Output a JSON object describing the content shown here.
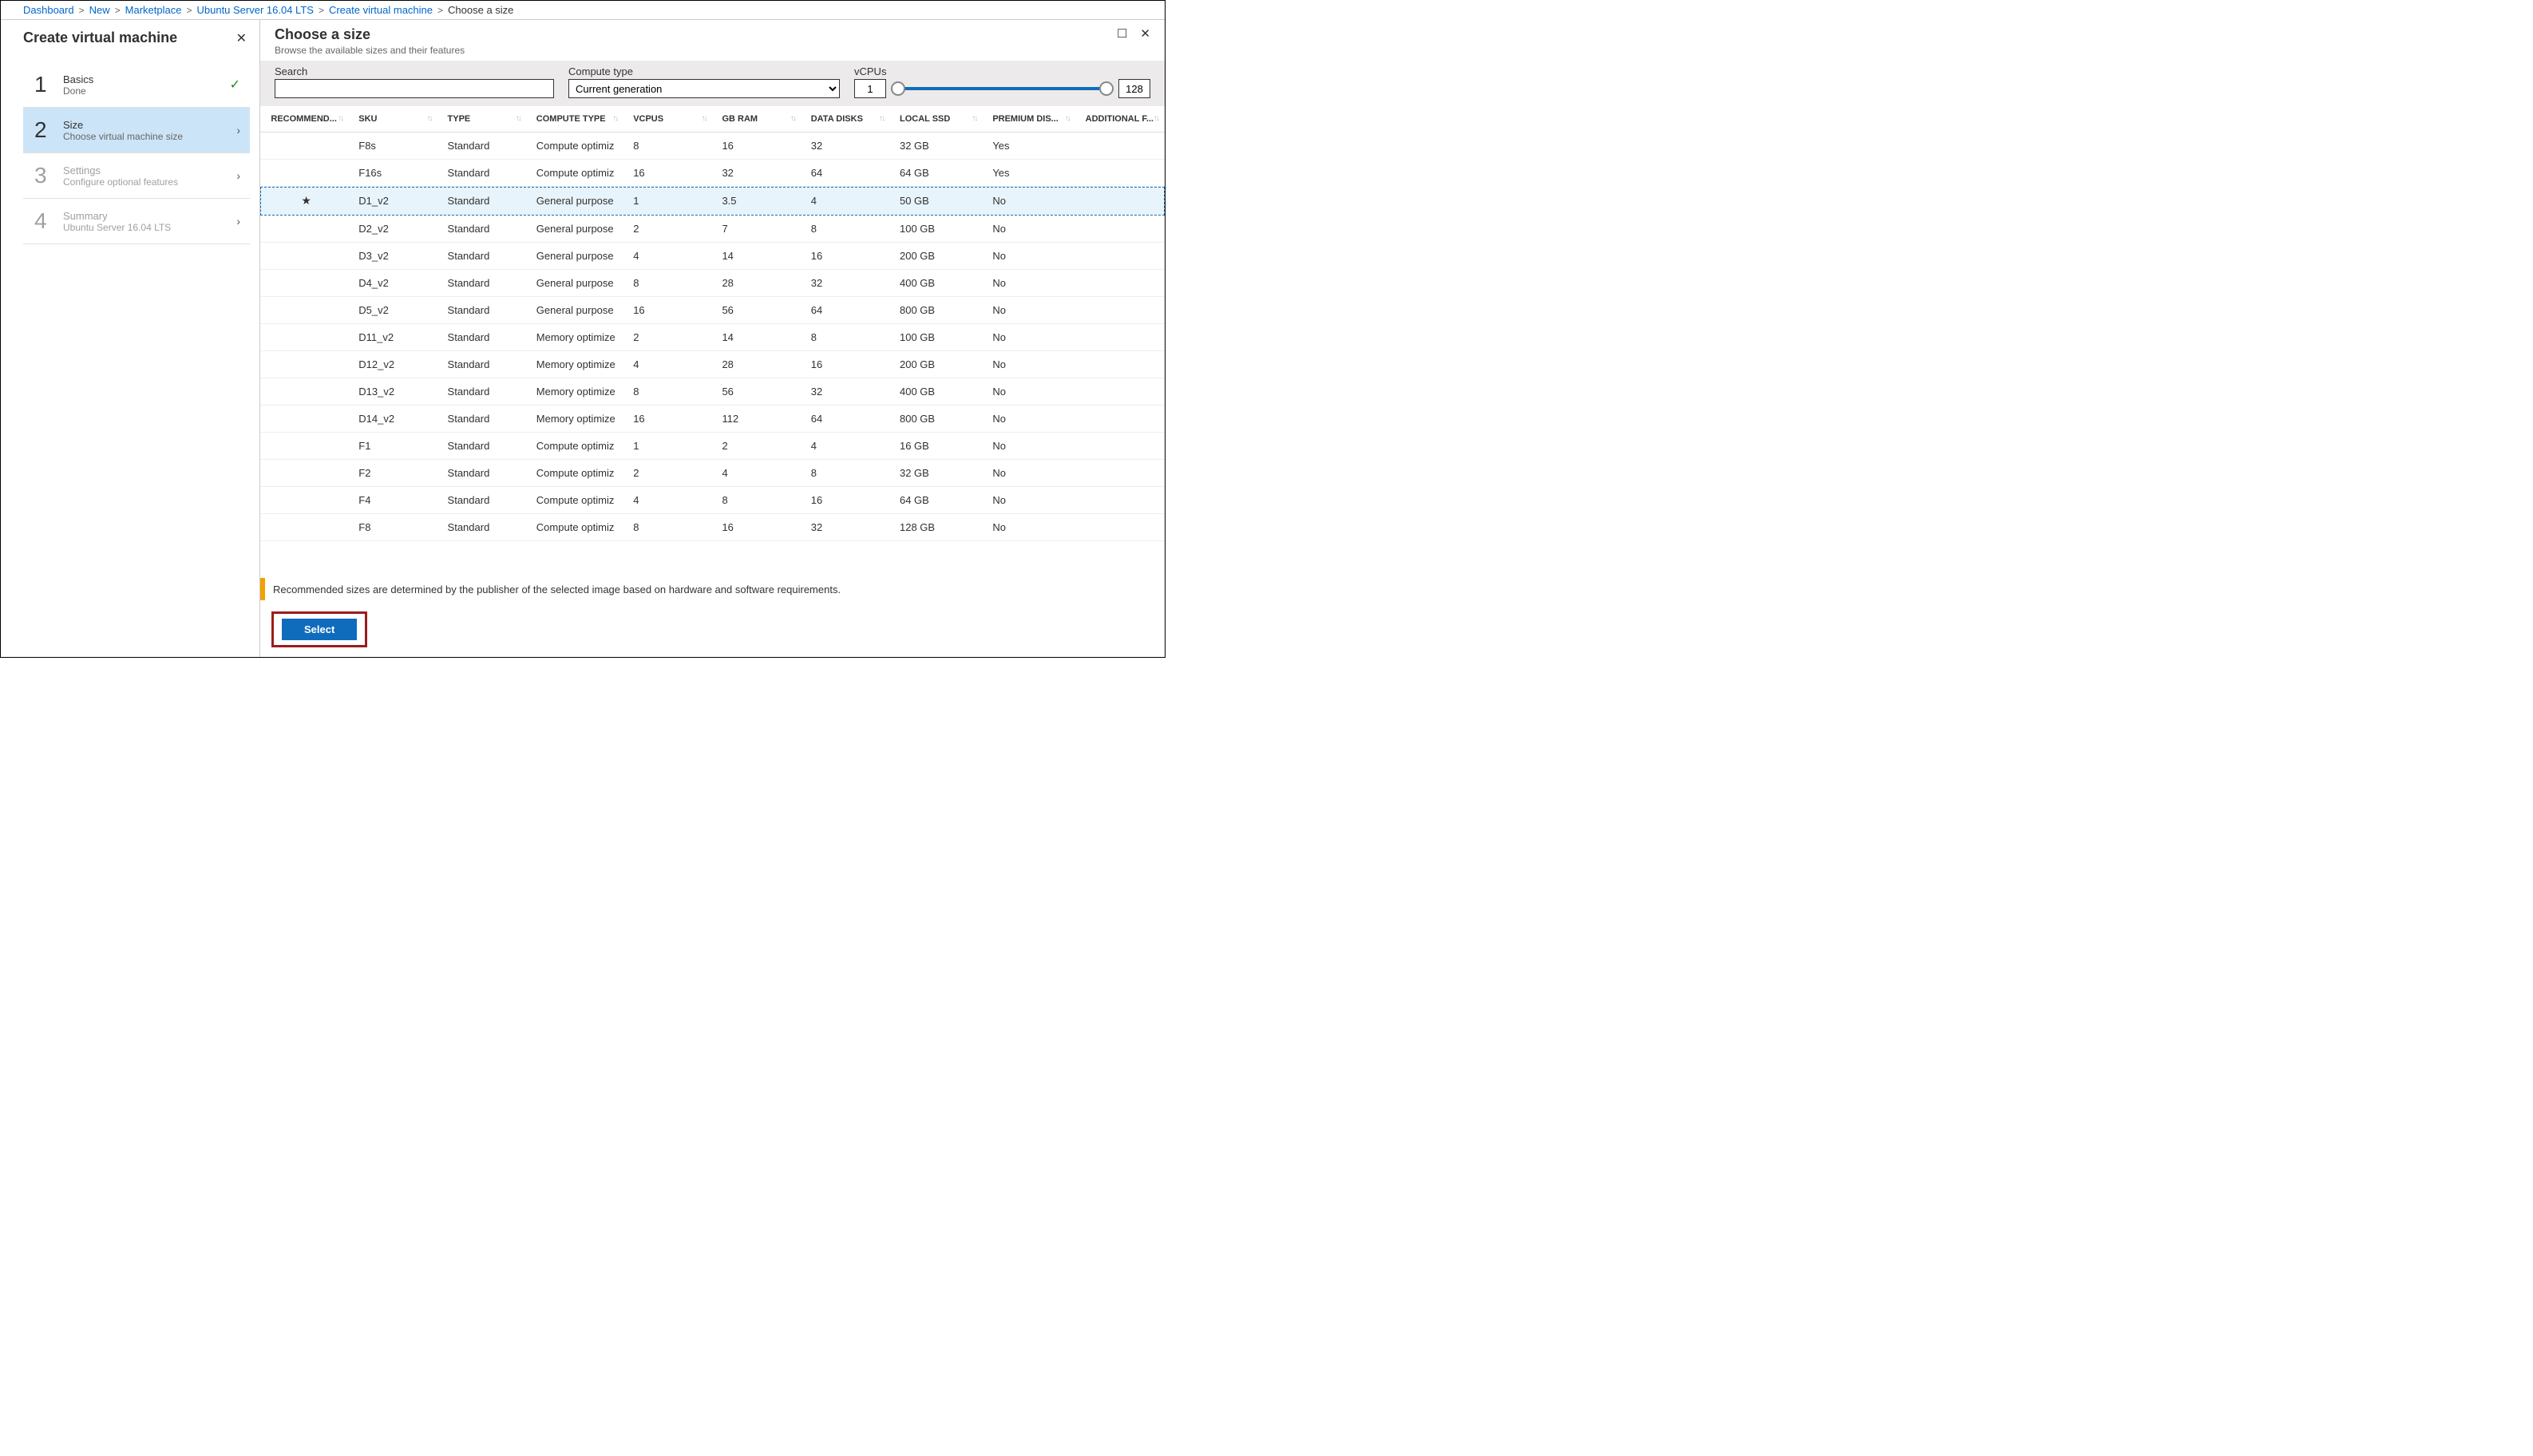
{
  "breadcrumb": [
    {
      "label": "Dashboard",
      "link": true
    },
    {
      "label": "New",
      "link": true
    },
    {
      "label": "Marketplace",
      "link": true
    },
    {
      "label": "Ubuntu Server 16.04 LTS",
      "link": true
    },
    {
      "label": "Create virtual machine",
      "link": true
    },
    {
      "label": "Choose a size",
      "link": false
    }
  ],
  "wizard": {
    "title": "Create virtual machine",
    "steps": [
      {
        "num": "1",
        "title": "Basics",
        "sub": "Done",
        "state": "done"
      },
      {
        "num": "2",
        "title": "Size",
        "sub": "Choose virtual machine size",
        "state": "active"
      },
      {
        "num": "3",
        "title": "Settings",
        "sub": "Configure optional features",
        "state": "muted"
      },
      {
        "num": "4",
        "title": "Summary",
        "sub": "Ubuntu Server 16.04 LTS",
        "state": "muted"
      }
    ]
  },
  "content": {
    "title": "Choose a size",
    "subtitle": "Browse the available sizes and their features"
  },
  "filters": {
    "search_label": "Search",
    "search_value": "",
    "compute_label": "Compute type",
    "compute_value": "Current generation",
    "vcpu_label": "vCPUs",
    "vcpu_min": "1",
    "vcpu_max": "128"
  },
  "columns": [
    "RECOMMEND...",
    "SKU",
    "TYPE",
    "COMPUTE TYPE",
    "VCPUS",
    "GB RAM",
    "DATA DISKS",
    "LOCAL SSD",
    "PREMIUM DIS...",
    "ADDITIONAL F..."
  ],
  "rows": [
    {
      "rec": "",
      "sku": "F8s",
      "type": "Standard",
      "ct": "Compute optimiz",
      "vcpu": "8",
      "ram": "16",
      "dd": "32",
      "ssd": "32 GB",
      "prem": "Yes",
      "add": ""
    },
    {
      "rec": "",
      "sku": "F16s",
      "type": "Standard",
      "ct": "Compute optimiz",
      "vcpu": "16",
      "ram": "32",
      "dd": "64",
      "ssd": "64 GB",
      "prem": "Yes",
      "add": ""
    },
    {
      "rec": "★",
      "sku": "D1_v2",
      "type": "Standard",
      "ct": "General purpose",
      "vcpu": "1",
      "ram": "3.5",
      "dd": "4",
      "ssd": "50 GB",
      "prem": "No",
      "add": "",
      "selected": true
    },
    {
      "rec": "",
      "sku": "D2_v2",
      "type": "Standard",
      "ct": "General purpose",
      "vcpu": "2",
      "ram": "7",
      "dd": "8",
      "ssd": "100 GB",
      "prem": "No",
      "add": ""
    },
    {
      "rec": "",
      "sku": "D3_v2",
      "type": "Standard",
      "ct": "General purpose",
      "vcpu": "4",
      "ram": "14",
      "dd": "16",
      "ssd": "200 GB",
      "prem": "No",
      "add": ""
    },
    {
      "rec": "",
      "sku": "D4_v2",
      "type": "Standard",
      "ct": "General purpose",
      "vcpu": "8",
      "ram": "28",
      "dd": "32",
      "ssd": "400 GB",
      "prem": "No",
      "add": ""
    },
    {
      "rec": "",
      "sku": "D5_v2",
      "type": "Standard",
      "ct": "General purpose",
      "vcpu": "16",
      "ram": "56",
      "dd": "64",
      "ssd": "800 GB",
      "prem": "No",
      "add": ""
    },
    {
      "rec": "",
      "sku": "D11_v2",
      "type": "Standard",
      "ct": "Memory optimize",
      "vcpu": "2",
      "ram": "14",
      "dd": "8",
      "ssd": "100 GB",
      "prem": "No",
      "add": ""
    },
    {
      "rec": "",
      "sku": "D12_v2",
      "type": "Standard",
      "ct": "Memory optimize",
      "vcpu": "4",
      "ram": "28",
      "dd": "16",
      "ssd": "200 GB",
      "prem": "No",
      "add": ""
    },
    {
      "rec": "",
      "sku": "D13_v2",
      "type": "Standard",
      "ct": "Memory optimize",
      "vcpu": "8",
      "ram": "56",
      "dd": "32",
      "ssd": "400 GB",
      "prem": "No",
      "add": ""
    },
    {
      "rec": "",
      "sku": "D14_v2",
      "type": "Standard",
      "ct": "Memory optimize",
      "vcpu": "16",
      "ram": "112",
      "dd": "64",
      "ssd": "800 GB",
      "prem": "No",
      "add": ""
    },
    {
      "rec": "",
      "sku": "F1",
      "type": "Standard",
      "ct": "Compute optimiz",
      "vcpu": "1",
      "ram": "2",
      "dd": "4",
      "ssd": "16 GB",
      "prem": "No",
      "add": ""
    },
    {
      "rec": "",
      "sku": "F2",
      "type": "Standard",
      "ct": "Compute optimiz",
      "vcpu": "2",
      "ram": "4",
      "dd": "8",
      "ssd": "32 GB",
      "prem": "No",
      "add": ""
    },
    {
      "rec": "",
      "sku": "F4",
      "type": "Standard",
      "ct": "Compute optimiz",
      "vcpu": "4",
      "ram": "8",
      "dd": "16",
      "ssd": "64 GB",
      "prem": "No",
      "add": ""
    },
    {
      "rec": "",
      "sku": "F8",
      "type": "Standard",
      "ct": "Compute optimiz",
      "vcpu": "8",
      "ram": "16",
      "dd": "32",
      "ssd": "128 GB",
      "prem": "No",
      "add": ""
    }
  ],
  "note": "Recommended sizes are determined by the publisher of the selected image based on hardware and software requirements.",
  "select_label": "Select"
}
